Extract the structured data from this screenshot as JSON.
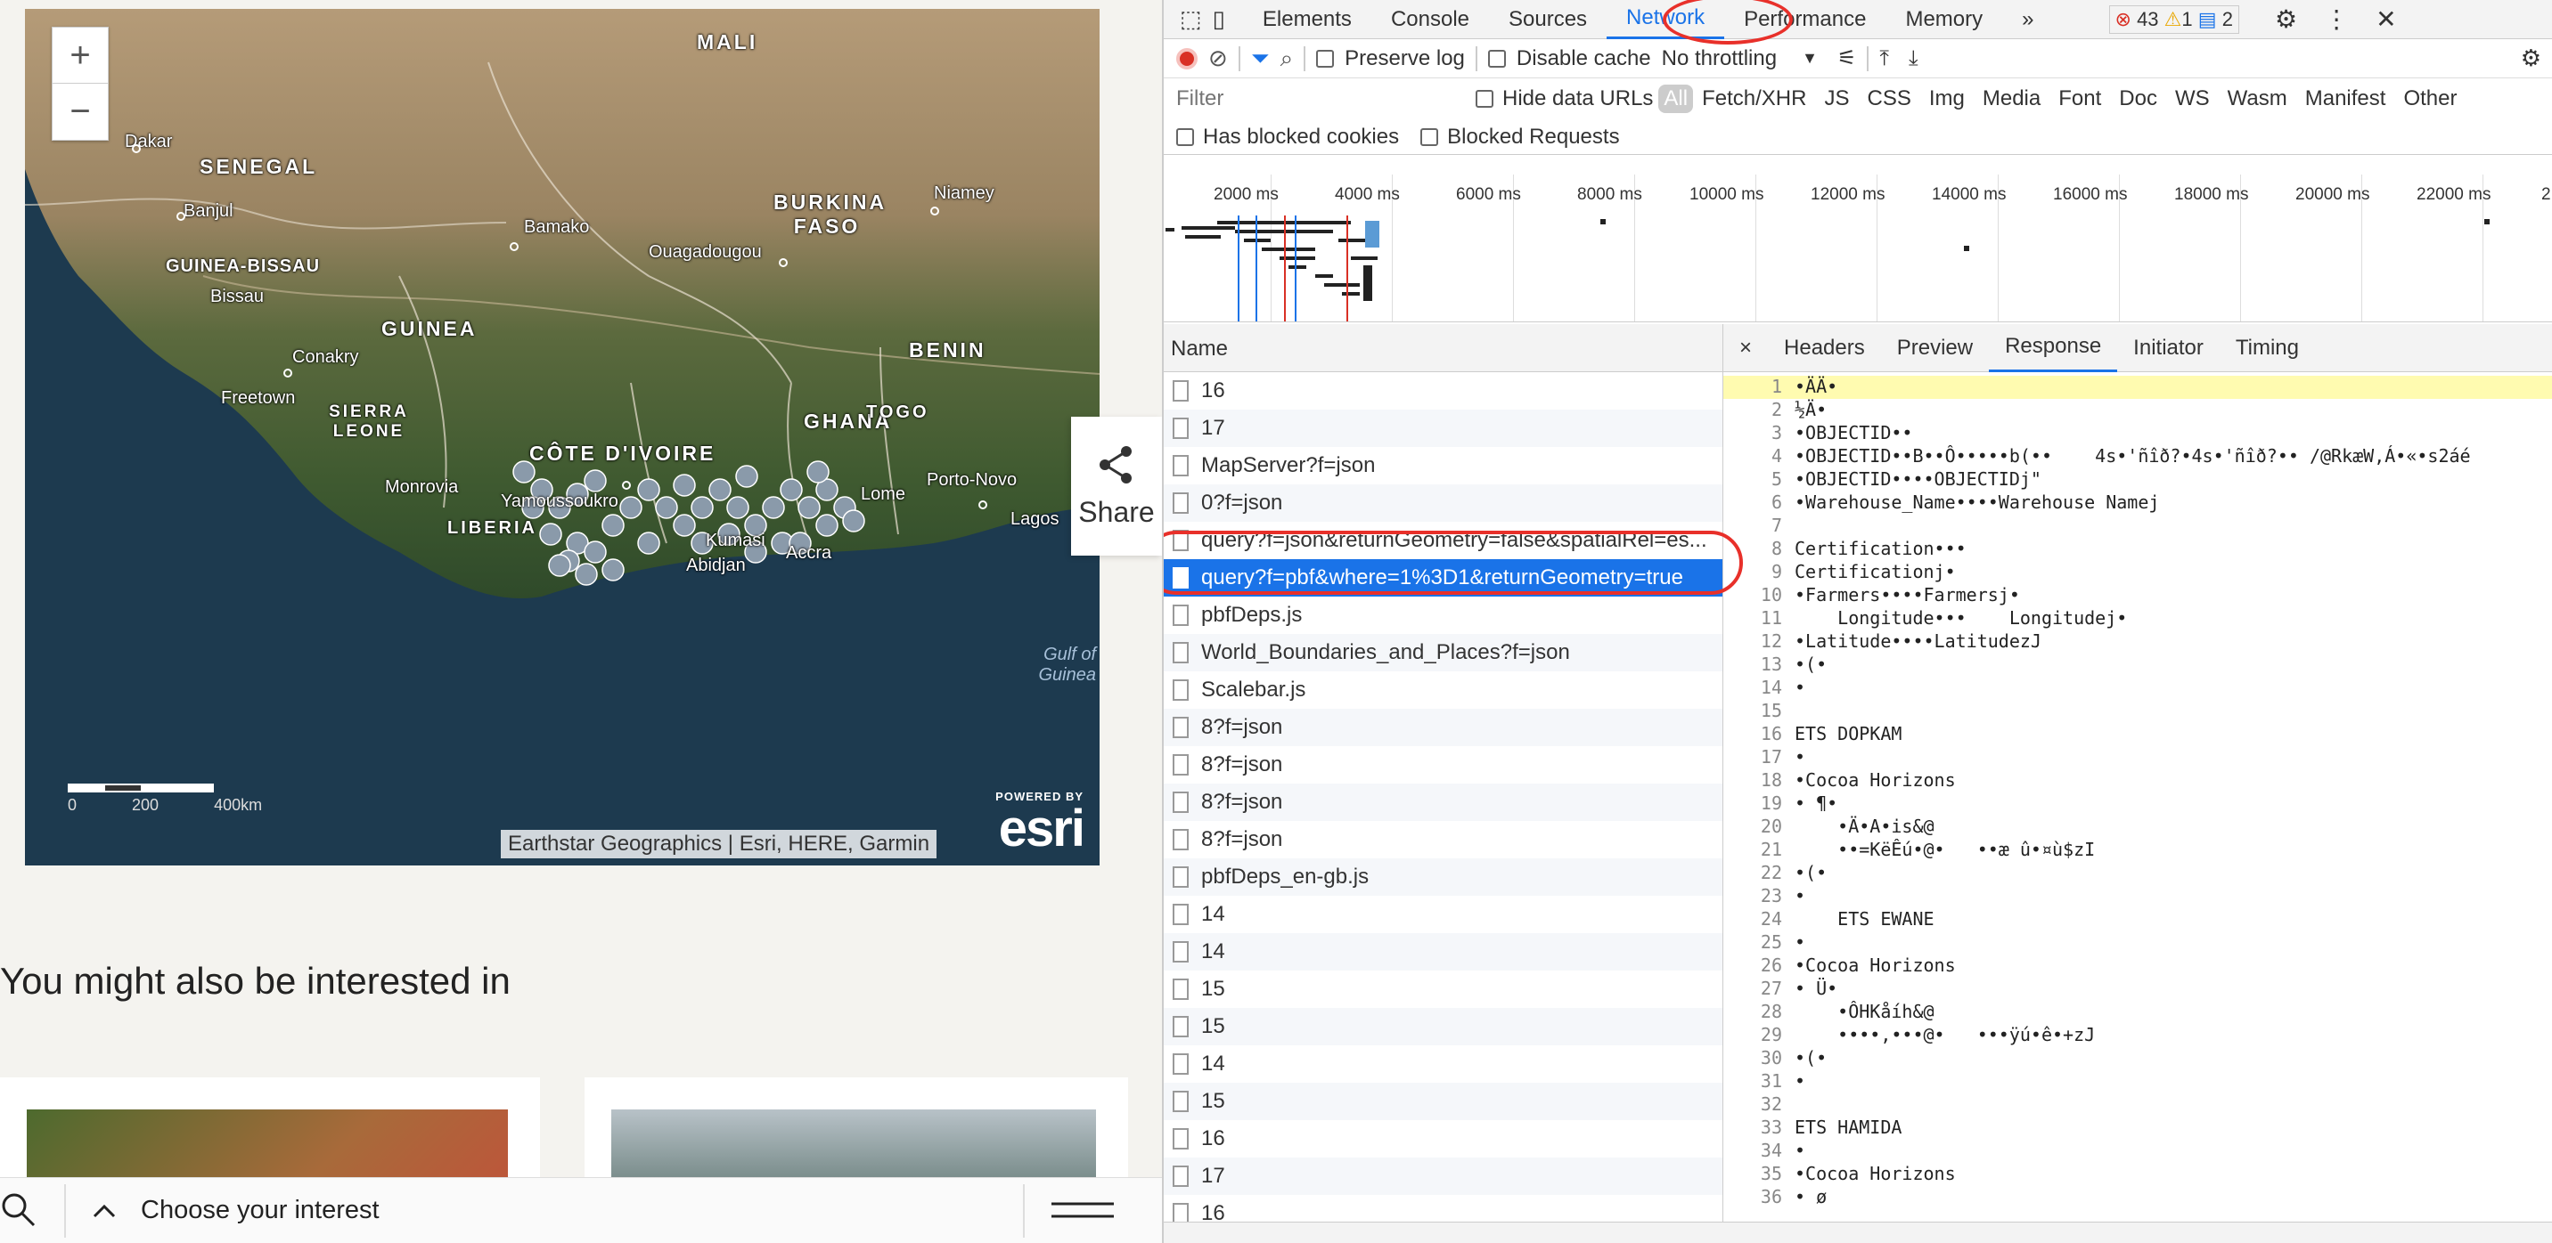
{
  "map": {
    "zoom_in": "+",
    "zoom_out": "−",
    "countries": [
      "MALI",
      "SENEGAL",
      "BURKINA FASO",
      "GUINEA",
      "BENIN",
      "SIERRA LEONE",
      "GHANA",
      "TOGO",
      "CÔTE D'IVOIRE",
      "LIBERIA",
      "GUINEA-BISSAU"
    ],
    "cities": [
      "Dakar",
      "Banjul",
      "Bissau",
      "Bamako",
      "Ouagadougou",
      "Niamey",
      "Conakry",
      "Freetown",
      "Monrovia",
      "Yamoussoukro",
      "Kumasi",
      "Lome",
      "Porto-Novo",
      "Lagos",
      "Abidjan",
      "Accra"
    ],
    "water": "Gulf of Guinea",
    "scale_labels": [
      "0",
      "200",
      "400km"
    ],
    "attribution": "Earthstar Geographics | Esri, HERE, Garmin",
    "esri_powered": "POWERED BY",
    "esri_logo": "esri"
  },
  "share": {
    "label": "Share",
    "icon": "share-icon"
  },
  "page": {
    "heading": "You might also be interested in",
    "bottom_label": "Choose your interest"
  },
  "devtools": {
    "tabs": [
      "Elements",
      "Console",
      "Sources",
      "Network",
      "Performance",
      "Memory"
    ],
    "active_tab": "Network",
    "more": "»",
    "errors": "43",
    "warnings": "1",
    "messages": "2",
    "preserve_log": "Preserve log",
    "disable_cache": "Disable cache",
    "throttling": "No throttling",
    "filter_placeholder": "Filter",
    "hide_data_urls": "Hide data URLs",
    "filter_types": [
      "All",
      "Fetch/XHR",
      "JS",
      "CSS",
      "Img",
      "Media",
      "Font",
      "Doc",
      "WS",
      "Wasm",
      "Manifest",
      "Other"
    ],
    "has_blocked_cookies": "Has blocked cookies",
    "blocked_requests": "Blocked Requests",
    "timeline_ticks": [
      "2000 ms",
      "4000 ms",
      "6000 ms",
      "8000 ms",
      "10000 ms",
      "12000 ms",
      "14000 ms",
      "16000 ms",
      "18000 ms",
      "20000 ms",
      "22000 ms",
      "2"
    ],
    "name_header": "Name",
    "requests": [
      "16",
      "17",
      "MapServer?f=json",
      "0?f=json",
      "query?f=json&returnGeometry=false&spatialRel=es...",
      "query?f=pbf&where=1%3D1&returnGeometry=true",
      "pbfDeps.js",
      "World_Boundaries_and_Places?f=json",
      "Scalebar.js",
      "8?f=json",
      "8?f=json",
      "8?f=json",
      "8?f=json",
      "pbfDeps_en-gb.js",
      "14",
      "14",
      "15",
      "15",
      "14",
      "15",
      "16",
      "17",
      "16"
    ],
    "selected_index": 5,
    "detail_close": "×",
    "detail_tabs": [
      "Headers",
      "Preview",
      "Response",
      "Initiator",
      "Timing"
    ],
    "detail_active": "Response",
    "response_lines": [
      "•ÄÄ•",
      "½Ä•",
      "•OBJECTID••",
      "•OBJECTID••B••Ô•••••b(••    4s•'ñîð?•4s•'ñîð?•• /@RkæW,Á•«•s2áé",
      "•OBJECTID••••OBJECTIDj\"",
      "•Warehouse_Name••••Warehouse Namej",
      "",
      "Certification•••",
      "Certificationj•",
      "•Farmers••••Farmersj•",
      "    Longitude•••    Longitudej•",
      "•Latitude••••LatitudezJ",
      "•(•",
      "•",
      "",
      "ETS DOPKAM",
      "•",
      "•Cocoa Horizons",
      "• ¶•",
      "    •Ä•A•is&@",
      "    ••=KëÊú•@•   ••æ û•¤ù$zI",
      "•(•",
      "•",
      "    ETS EWANE",
      "•",
      "•Cocoa Horizons",
      "• Ü•",
      "    •ÔHKåíh&@",
      "    ••••,•••@•   •••ÿú•ê•+zJ",
      "•(•",
      "•",
      "",
      "ETS HAMIDA",
      "•",
      "•Cocoa Horizons",
      "• ø"
    ]
  }
}
